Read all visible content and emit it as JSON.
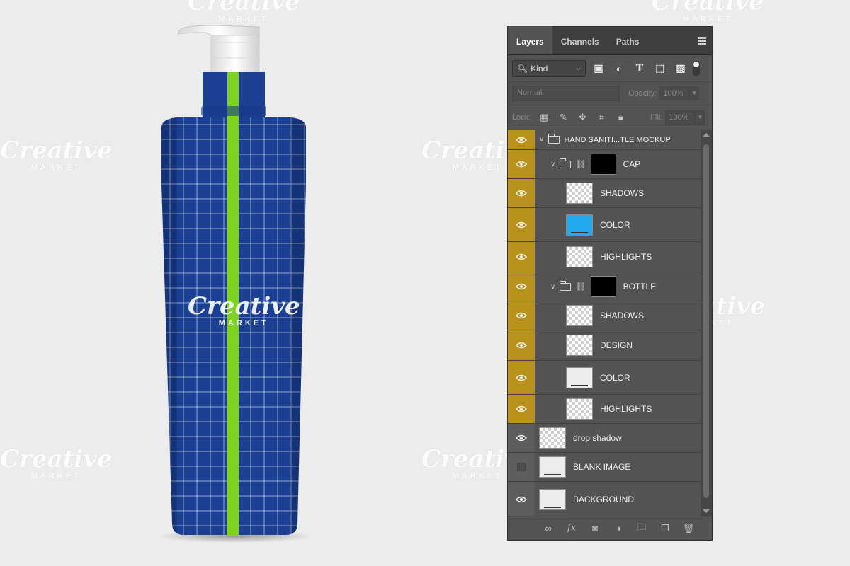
{
  "watermark": {
    "brand": "Creative",
    "sub": "MARKET"
  },
  "colors": {
    "bottle": "#1a3f93",
    "stripe": "#7ed321",
    "eye_active": "#b8921c",
    "panel": "#535353"
  },
  "panel": {
    "tabs": [
      {
        "label": "Layers",
        "active": true
      },
      {
        "label": "Channels",
        "active": false
      },
      {
        "label": "Paths",
        "active": false
      }
    ],
    "filter_kind": "Kind",
    "filter_icons": [
      "image-filter-icon",
      "adjustment-filter-icon",
      "type-filter-icon",
      "shape-filter-icon",
      "smart-object-filter-icon"
    ],
    "blend_mode": "Normal",
    "opacity_label": "Opacity:",
    "opacity_value": "100%",
    "lock_label": "Lock:",
    "fill_label": "Fill:",
    "fill_value": "100%"
  },
  "layers": [
    {
      "name": "HAND SANITI...TLE MOCKUP",
      "type": "group",
      "indent": 0,
      "visible": true,
      "highlight": true
    },
    {
      "name": "CAP",
      "type": "group-mask",
      "indent": 1,
      "visible": true,
      "highlight": true,
      "thumb": "black"
    },
    {
      "name": "SHADOWS",
      "type": "layer",
      "indent": 2,
      "visible": true,
      "highlight": true,
      "thumb": "checker"
    },
    {
      "name": "COLOR",
      "type": "layer",
      "indent": 2,
      "visible": true,
      "highlight": true,
      "thumb": "blue"
    },
    {
      "name": "HIGHLIGHTS",
      "type": "layer",
      "indent": 2,
      "visible": true,
      "highlight": true,
      "thumb": "checker"
    },
    {
      "name": "BOTTLE",
      "type": "group-mask",
      "indent": 1,
      "visible": true,
      "highlight": true,
      "thumb": "black"
    },
    {
      "name": "SHADOWS",
      "type": "layer",
      "indent": 2,
      "visible": true,
      "highlight": true,
      "thumb": "checker"
    },
    {
      "name": "DESIGN",
      "type": "layer",
      "indent": 2,
      "visible": true,
      "highlight": true,
      "thumb": "checker"
    },
    {
      "name": "COLOR",
      "type": "layer",
      "indent": 2,
      "visible": true,
      "highlight": true,
      "thumb": "white"
    },
    {
      "name": "HIGHLIGHTS",
      "type": "layer",
      "indent": 2,
      "visible": true,
      "highlight": true,
      "thumb": "checker"
    },
    {
      "name": "drop shadow",
      "type": "layer",
      "indent": 0,
      "visible": true,
      "highlight": false,
      "thumb": "checker"
    },
    {
      "name": "BLANK IMAGE",
      "type": "layer",
      "indent": 0,
      "visible": false,
      "highlight": false,
      "thumb": "white"
    },
    {
      "name": "BACKGROUND",
      "type": "layer",
      "indent": 0,
      "visible": true,
      "highlight": false,
      "thumb": "white"
    }
  ],
  "footer_icons": [
    "link-layers-icon",
    "fx-icon",
    "add-mask-icon",
    "adjustment-layer-icon",
    "new-group-icon",
    "new-layer-icon",
    "delete-layer-icon"
  ]
}
